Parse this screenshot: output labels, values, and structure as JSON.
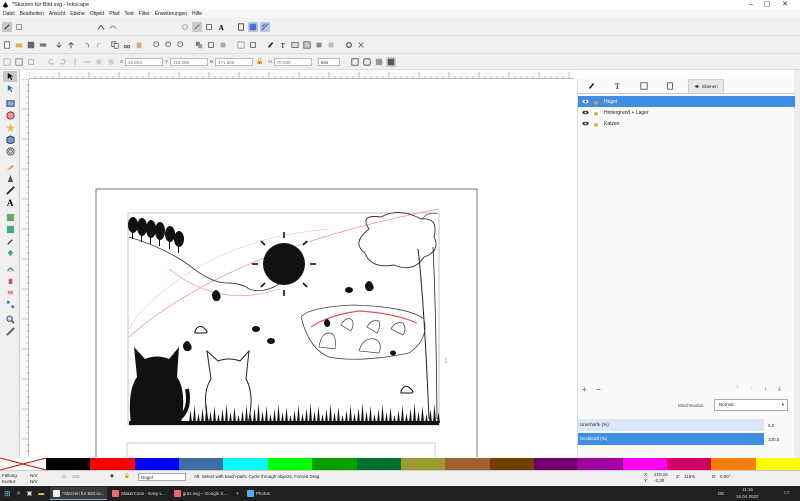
{
  "window": {
    "title": "*Skizzen für Bild.svg - Inkscape"
  },
  "menu": [
    "Datei",
    "Bearbeiten",
    "Ansicht",
    "Ebene",
    "Objekt",
    "Pfad",
    "Text",
    "Filter",
    "Erweiterungen",
    "Hilfe"
  ],
  "toolcontrols": {
    "x_label": "X",
    "x_value": "16,603",
    "y_label": "Y",
    "y_value": "115,386",
    "w_label": "B",
    "w_value": "171,505",
    "h_label": "H",
    "h_value": "70,030",
    "unit": "mm"
  },
  "panel": {
    "tab_label": "Ebenen",
    "layers": [
      {
        "name": "Hügel",
        "selected": true
      },
      {
        "name": "Hintergrund + Lager",
        "selected": false
      },
      {
        "name": "Katzen",
        "selected": false
      }
    ],
    "blend_label": "Mischmodus:",
    "blend_value": "Normal",
    "blur_label": "Unschärfe (%)",
    "blur_value": "0,0",
    "opacity_label": "Deckkraft (%)",
    "opacity_value": "100,0"
  },
  "palette": [
    "#000000",
    "#ff0000",
    "#0000ff",
    "#3a6ea5",
    "#00ffff",
    "#00ff00",
    "#00a000",
    "#007030",
    "#9a9a30",
    "#a06030",
    "#704000",
    "#700070",
    "#a000a0",
    "#ff00ff",
    "#d00060",
    "#ff8000",
    "#ffff00"
  ],
  "status": {
    "fill_label": "Füllung:",
    "fill_value": "N/V",
    "stroke_label": "Kontur:",
    "stroke_value": "N/V",
    "layer_value": "Hügel",
    "hint": "Alt: Select with touch-path, Cycle through objects, Forced Drag",
    "opacity_value": "100",
    "coord_x_label": "X:",
    "coord_x": "210,15",
    "coord_y_label": "Y:",
    "coord_y": "-2,30",
    "zoom_label": "Z:",
    "zoom": "115%",
    "rotation_label": "D:",
    "rotation": "0,00°"
  },
  "taskbar": {
    "items": [
      {
        "label": "*Skizzen für Bild.sv...",
        "active": true
      },
      {
        "label": "MakerCase - Easy L...",
        "active": false
      },
      {
        "label": "gras.svg – Google S...",
        "active": false
      },
      {
        "label": "Photos",
        "active": false
      }
    ],
    "lang": "DE",
    "time": "11:16",
    "date": "16.04.2022"
  }
}
